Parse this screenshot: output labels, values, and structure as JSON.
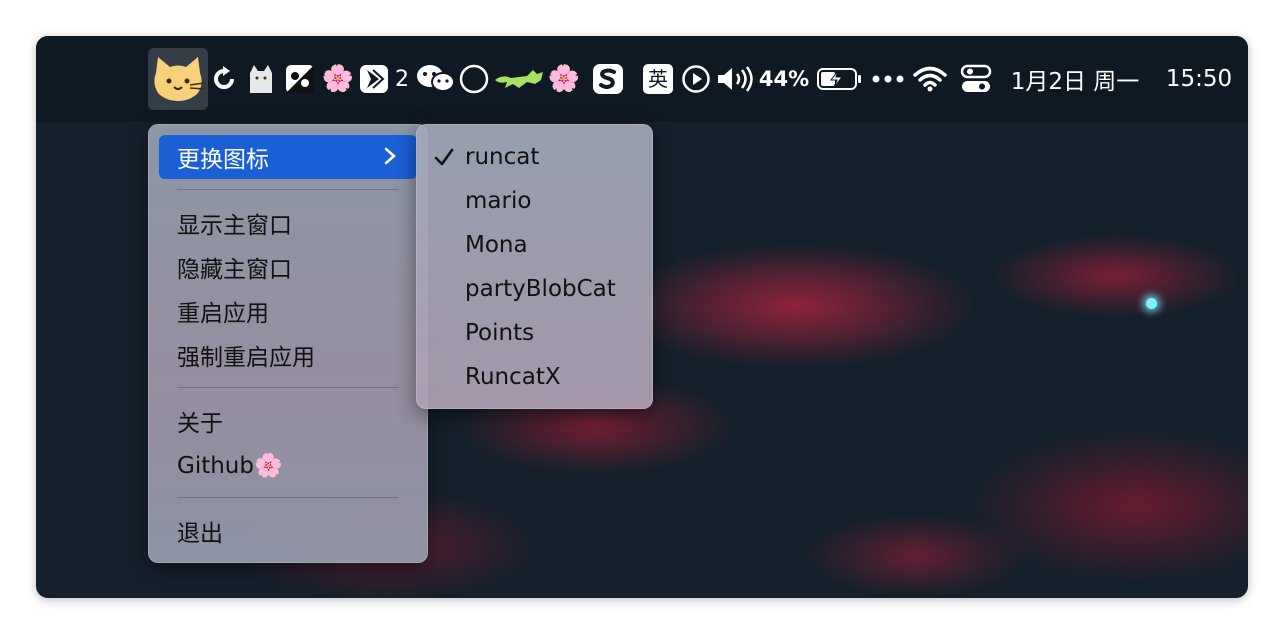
{
  "menubar": {
    "runcat_icon": "runcat-cat-icon",
    "icons": [
      "refresh-icon",
      "cat-silhouette-icon",
      "yin-yang-icon",
      "cherry-blossom-icon",
      "feishu-icon",
      "wechat-icon",
      "circle-icon",
      "running-cat-icon",
      "cherry-blossom-icon",
      "sogou-icon"
    ],
    "badge_count": "2",
    "input_method": "英",
    "volume_pct": "44%",
    "date": "1月2日 周一",
    "time": "15:50"
  },
  "menu": {
    "items": [
      {
        "label": "更换图标",
        "has_submenu": true,
        "highlighted": true
      },
      {
        "label": "显示主窗口"
      },
      {
        "label": "隐藏主窗口"
      },
      {
        "label": "重启应用"
      },
      {
        "label": "强制重启应用"
      },
      {
        "label": "关于"
      },
      {
        "label": "Github🌸"
      },
      {
        "label": "退出"
      }
    ]
  },
  "submenu": {
    "items": [
      {
        "label": "runcat",
        "checked": true
      },
      {
        "label": "mario"
      },
      {
        "label": "Mona"
      },
      {
        "label": "partyBlobCat"
      },
      {
        "label": "Points"
      },
      {
        "label": "RuncatX"
      }
    ]
  },
  "colors": {
    "highlight": "#1b5fd6",
    "menubar": "#0f1923",
    "cat_yellow": "#f8d27a",
    "running_cat_green": "#a8e063"
  }
}
